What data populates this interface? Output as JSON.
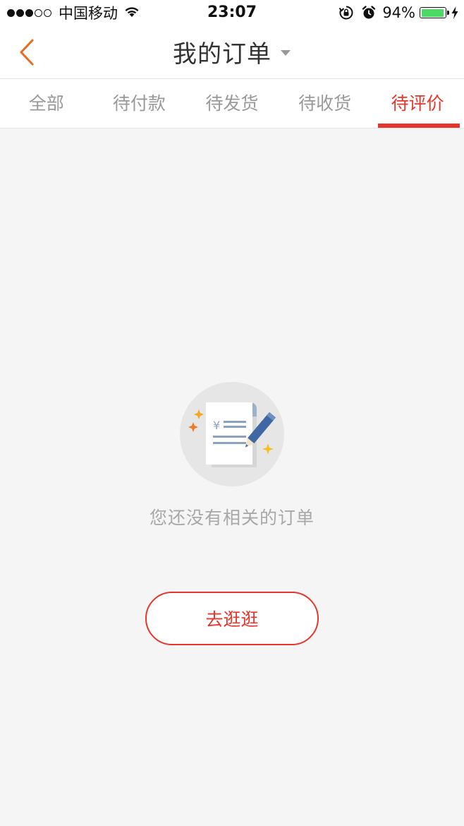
{
  "status_bar": {
    "carrier": "中国移动",
    "time": "23:07",
    "battery_percent": "94%",
    "battery_level": 0.94,
    "signal_bars": 3,
    "signal_total": 5
  },
  "nav": {
    "title": "我的订单",
    "back_icon": "chevron-left-icon",
    "dropdown_icon": "caret-down-icon"
  },
  "tabs": [
    {
      "label": "全部",
      "active": false
    },
    {
      "label": "待付款",
      "active": false
    },
    {
      "label": "待发货",
      "active": false
    },
    {
      "label": "待收货",
      "active": false
    },
    {
      "label": "待评价",
      "active": true
    }
  ],
  "empty_state": {
    "illustration_icon": "order-review-icon",
    "message": "您还没有相关的订单",
    "button_label": "去逛逛"
  },
  "colors": {
    "accent": "#e7352b",
    "back_arrow": "#e86b1f",
    "battery": "#4cd964",
    "background": "#f5f5f5"
  }
}
